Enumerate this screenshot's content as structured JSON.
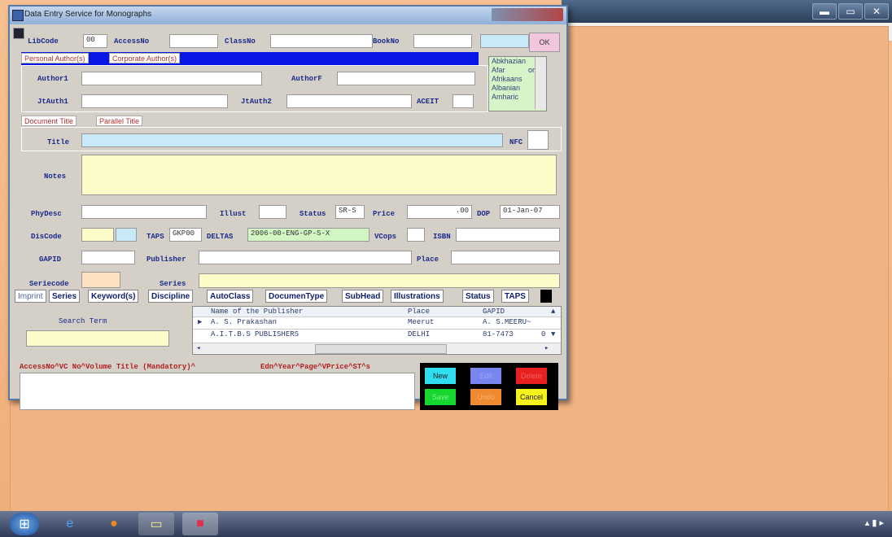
{
  "window": {
    "title": "Data Entry Service for Monographs"
  },
  "header_row": {
    "libcode_label": "LibCode",
    "libcode_value": "00",
    "accessno_label": "AccessNo",
    "classno_label": "ClassNo",
    "bookno_label": "BookNo",
    "ok_label": "OK"
  },
  "author_tabs": [
    "Personal Author(s)",
    "Corporate Author(s)"
  ],
  "authors": {
    "author1_label": "Author1",
    "authorf_label": "AuthorF",
    "jtauth1_label": "JtAuth1",
    "jtauth2_label": "JtAuth2",
    "aceit_label": "ACEIT"
  },
  "languages": [
    "Abkhazian",
    "Afar",
    "Afrikaans",
    "Albanian",
    "Amharic"
  ],
  "lang_extra": "or",
  "title_tabs": [
    "Document Title",
    "Parallel Title"
  ],
  "title_row": {
    "title_label": "Title",
    "nfc_label": "NFC"
  },
  "notes_label": "Notes",
  "desc_row": {
    "phydesc_label": "PhyDesc",
    "illust_label": "Illust",
    "status_label": "Status",
    "status_value": "SR-S",
    "price_label": "Price",
    "price_value": ".00",
    "dop_label": "DOP",
    "dop_value": "01-Jan-07"
  },
  "code_row": {
    "discode_label": "DisCode",
    "taps_label": "TAPS",
    "taps_value": "GKP00",
    "deltas_label": "DELTAS",
    "deltas_value": "2006-00-ENG-GP-S-X",
    "vcops_label": "VCops",
    "isbn_label": "ISBN"
  },
  "pub_row": {
    "gapid_label": "GAPID",
    "publisher_label": "Publisher",
    "place_label": "Place"
  },
  "series_row": {
    "seriecode_label": "Seriecode",
    "series_label": "Series"
  },
  "bottom_tabs": [
    "Imprint",
    "Series",
    "Keyword(s)",
    "Discipline",
    "AutoClass",
    "DocumenType",
    "SubHead",
    "Illustrations",
    "Status",
    "TAPS"
  ],
  "search": {
    "label": "Search Term"
  },
  "grid": {
    "headers": [
      "Name of the Publisher",
      "Place",
      "GAPID"
    ],
    "rows": [
      [
        "A. S. Prakashan",
        "Meerut",
        "A. S.MEERU~"
      ],
      [
        "A.I.T.B.S PUBLISHERS",
        "DELHI",
        "81-7473"
      ]
    ],
    "row2_tail": "0"
  },
  "footer": {
    "mandatory_text": "AccessNo^VC No^Volume Title (Mandatory)^",
    "extra_text": "Edn^Year^Page^VPrice^ST^s"
  },
  "buttons": {
    "new": "New",
    "edit": "Edit",
    "delete": "Delete",
    "save": "Save",
    "undo": "Undo",
    "cancel": "Cancel"
  }
}
